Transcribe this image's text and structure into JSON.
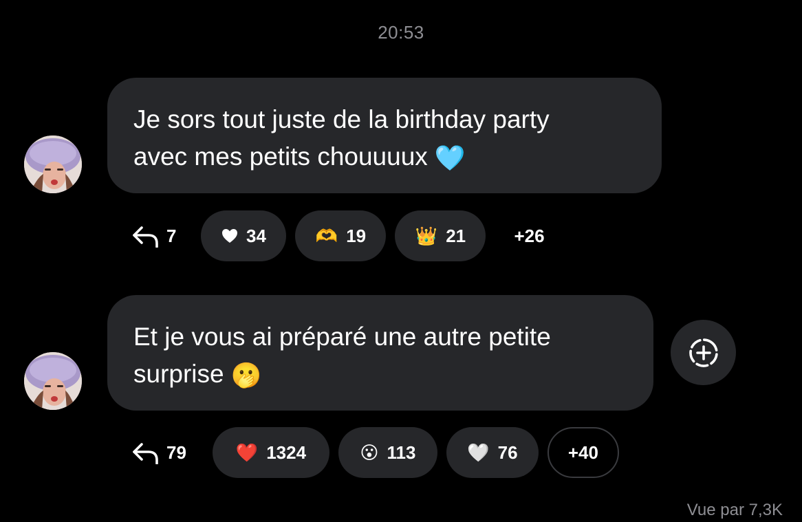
{
  "timestamp": "20:53",
  "messages": [
    {
      "text_line1": "Je sors tout juste de la birthday party",
      "text_line2": "avec mes petits chouuuux",
      "emoji": "🩵",
      "reply_count": "7",
      "reactions": [
        {
          "emoji": "heart-white-small",
          "count": "34"
        },
        {
          "emoji": "🫶",
          "count": "19"
        },
        {
          "emoji": "👑",
          "count": "21"
        }
      ],
      "more": "+26"
    },
    {
      "text_line1": "Et je vous ai préparé une autre petite",
      "text_line2": "surprise",
      "emoji": "🫢",
      "reply_count": "79",
      "reactions": [
        {
          "emoji": "❤️",
          "count": "1324"
        },
        {
          "emoji": "😮",
          "count": "113"
        },
        {
          "emoji": "🤍",
          "count": "76"
        }
      ],
      "more": "+40"
    }
  ],
  "seen_by": "Vue par 7,3K",
  "icons": {
    "reply": "reply-arrow-icon",
    "story": "add-circle-dashed-icon",
    "avatar": "user-avatar"
  },
  "colors": {
    "background": "#000000",
    "bubble": "#26272a",
    "secondary_text": "#8e8e93"
  }
}
